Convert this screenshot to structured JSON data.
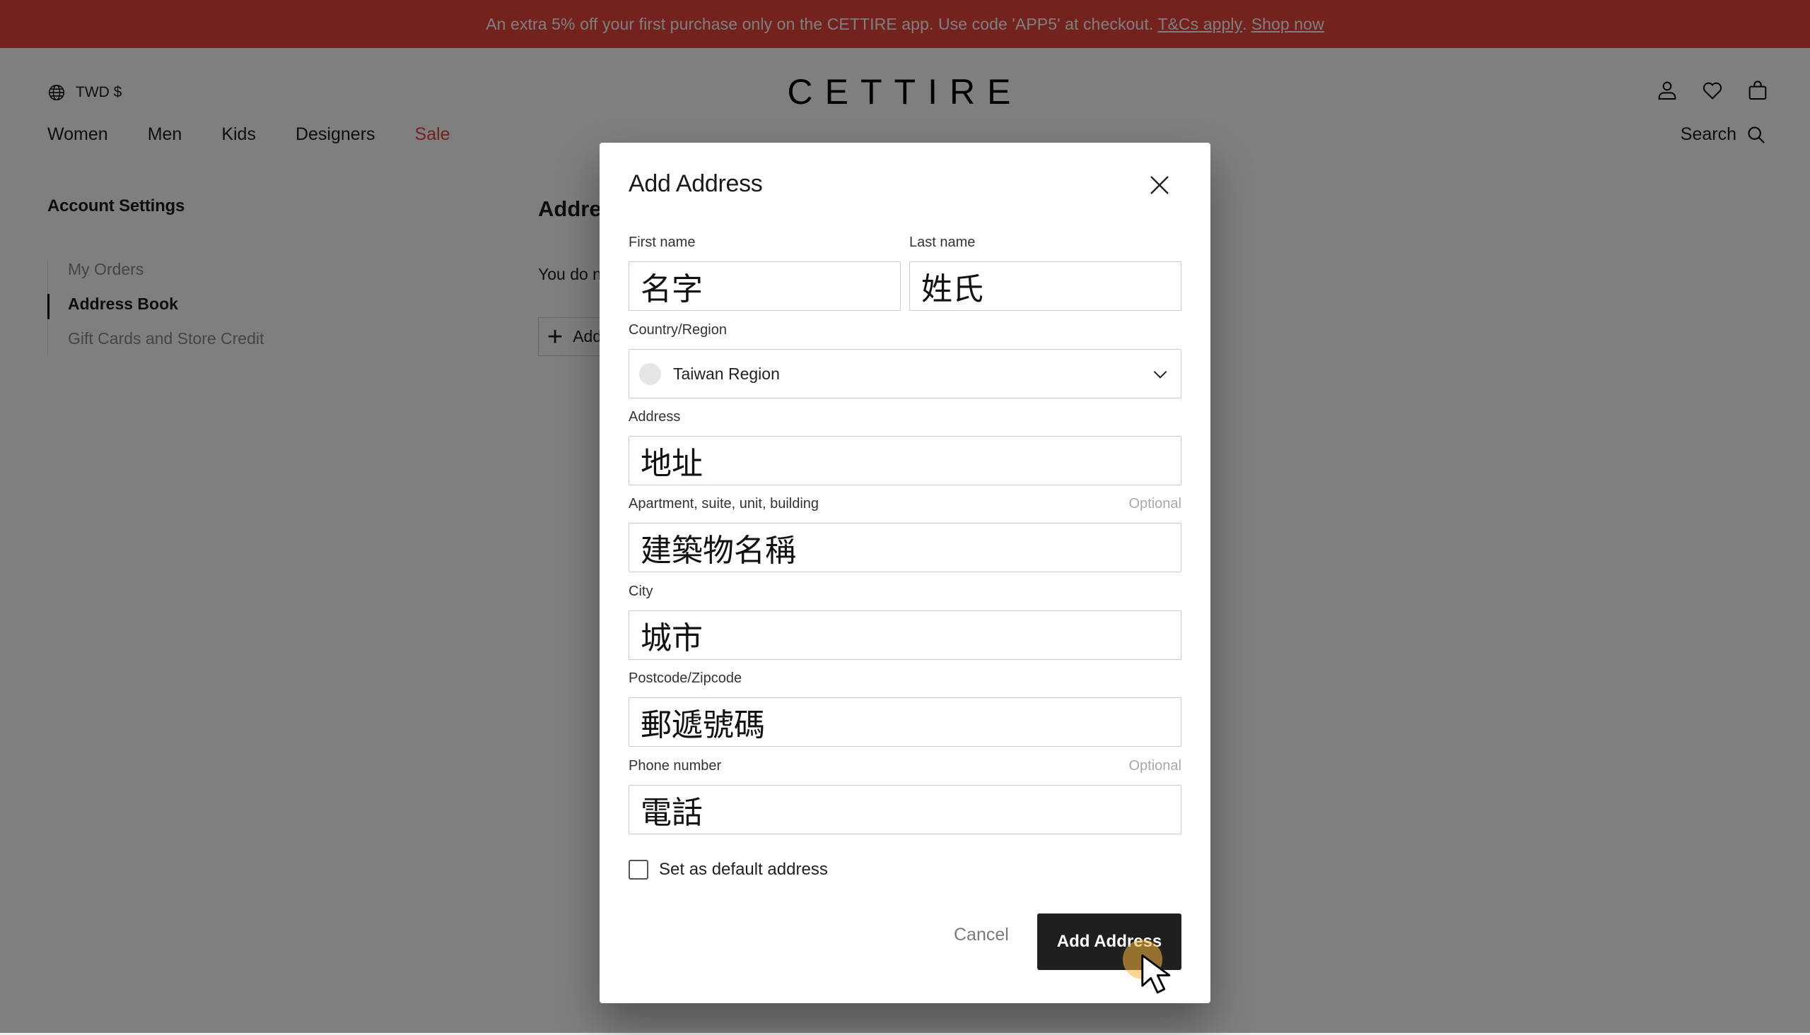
{
  "promo": {
    "text": "An extra 5% off your first purchase only on the CETTIRE app. Use code 'APP5' at checkout.",
    "terms_link": "T&Cs apply",
    "separator": ".",
    "shop_link": "Shop now",
    "color": "#e8453a"
  },
  "header": {
    "currency": "TWD $",
    "logo": "CETTIRE",
    "icons": [
      "account-icon",
      "wishlist-heart-icon",
      "shopping-bag-icon"
    ],
    "nav": [
      "Women",
      "Men",
      "Kids",
      "Designers",
      "Sale"
    ],
    "search_label": "Search"
  },
  "sidebar": {
    "title": "Account Settings",
    "items": [
      {
        "label": "My Orders",
        "active": false
      },
      {
        "label": "Address Book",
        "active": true
      },
      {
        "label": "Gift Cards and Store Credit",
        "active": false
      }
    ]
  },
  "main": {
    "title": "Address Book",
    "empty_text": "You do not have any saved addresses",
    "add_button": "Add Address"
  },
  "modal": {
    "title": "Add Address",
    "fields": {
      "first_name": {
        "label": "First name",
        "value": "名字"
      },
      "last_name": {
        "label": "Last name",
        "value": "姓氏"
      },
      "country": {
        "label": "Country/Region",
        "value": "Taiwan Region"
      },
      "address": {
        "label": "Address",
        "value": "地址"
      },
      "apartment": {
        "label": "Apartment, suite, unit, building",
        "optional": "Optional",
        "value": "建築物名稱"
      },
      "city": {
        "label": "City",
        "value": "城市"
      },
      "postcode": {
        "label": "Postcode/Zipcode",
        "value": "郵遞號碼"
      },
      "phone": {
        "label": "Phone number",
        "optional": "Optional",
        "value": "電話"
      }
    },
    "default_checkbox": {
      "label": "Set as default address",
      "checked": false
    },
    "cancel_label": "Cancel",
    "submit_label": "Add Address"
  }
}
